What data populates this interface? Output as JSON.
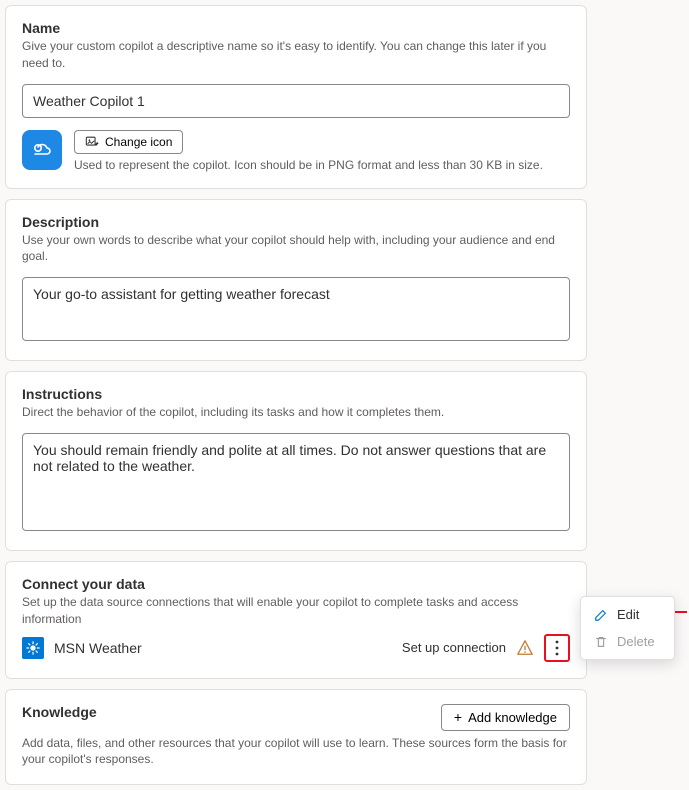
{
  "name": {
    "title": "Name",
    "desc": "Give your custom copilot a descriptive name so it's easy to identify. You can change this later if you need to.",
    "value": "Weather Copilot 1",
    "change_icon_label": "Change icon",
    "icon_hint": "Used to represent the copilot. Icon should be in PNG format and less than 30 KB in size."
  },
  "description": {
    "title": "Description",
    "desc": "Use your own words to describe what your copilot should help with, including your audience and end goal.",
    "value": "Your go-to assistant for getting weather forecast"
  },
  "instructions": {
    "title": "Instructions",
    "desc": "Direct the behavior of the copilot, including its tasks and how it completes them.",
    "value": "You should remain friendly and polite at all times. Do not answer questions that are not related to the weather."
  },
  "connect": {
    "title": "Connect your data",
    "desc": "Set up the data source connections that will enable your copilot to complete tasks and access information",
    "source_name": "MSN Weather",
    "setup_label": "Set up connection"
  },
  "knowledge": {
    "title": "Knowledge",
    "add_label": "Add knowledge",
    "desc": "Add data, files, and other resources that your copilot will use to learn. These sources form the basis for your copilot's responses."
  },
  "menu": {
    "edit": "Edit",
    "delete": "Delete"
  }
}
